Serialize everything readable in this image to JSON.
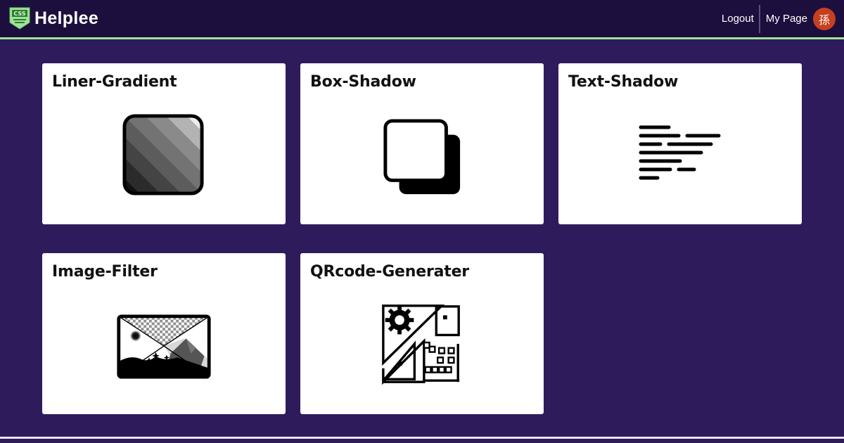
{
  "header": {
    "brand": "Helplee",
    "logo_text": "CSS",
    "logout_label": "Logout",
    "mypage_label": "My Page",
    "avatar_char": "孫"
  },
  "colors": {
    "page_bg": "#2e1b5c",
    "header_bg": "#1d0f3d",
    "header_accent": "#9fe39a",
    "avatar_bg": "#c6401f",
    "card_bg": "#ffffff"
  },
  "cards": [
    {
      "title": "Liner-Gradient",
      "icon": "linear-gradient-icon"
    },
    {
      "title": "Box-Shadow",
      "icon": "box-shadow-icon"
    },
    {
      "title": "Text-Shadow",
      "icon": "text-lines-icon"
    },
    {
      "title": "Image-Filter",
      "icon": "image-filter-icon"
    },
    {
      "title": "QRcode-Generater",
      "icon": "qrcode-icon"
    }
  ]
}
